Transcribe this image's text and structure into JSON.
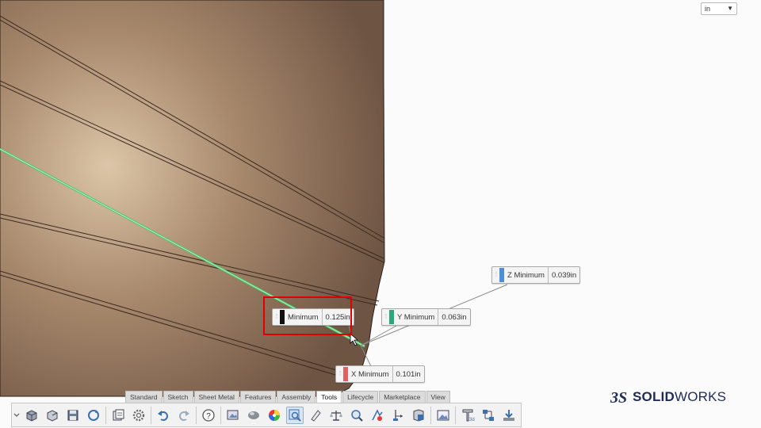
{
  "units": {
    "selected": "in"
  },
  "callouts": {
    "minimum": {
      "label": "Minimum",
      "value": "0.125in",
      "color": "#111111"
    },
    "y_minimum": {
      "label": "Y Minimum",
      "value": "0.063in",
      "color": "#2aa87a"
    },
    "z_minimum": {
      "label": "Z Minimum",
      "value": "0.039in",
      "color": "#4a8fd8"
    },
    "x_minimum": {
      "label": "X Minimum",
      "value": "0.101in",
      "color": "#e06060"
    }
  },
  "command_tabs": [
    "Standard",
    "Sketch",
    "Sheet Metal",
    "Features",
    "Assembly",
    "Tools",
    "Lifecycle",
    "Marketplace",
    "View"
  ],
  "active_tab": "Tools",
  "toolbar_icons": [
    "new-part-icon",
    "open-icon",
    "save-icon",
    "rebuild-icon",
    "options-doc-icon",
    "settings-gear-icon",
    "undo-icon",
    "redo-icon",
    "help-icon",
    "render-tools-icon",
    "appearance-icon",
    "color-wheel-icon",
    "measure-icon",
    "sketch-tool-icon",
    "mass-properties-icon",
    "section-view-icon",
    "interference-icon",
    "dimension-expert-icon",
    "check-icon",
    "photo-icon",
    "3d-text-icon",
    "compare-icon",
    "export-icon"
  ],
  "brand": {
    "logo_mark": "3S",
    "name_bold": "SOLID",
    "name_regular": "WORKS",
    "color": "#1e2c56"
  },
  "colors": {
    "model_surface": "#9a7c62",
    "highlight": "#e00000",
    "edge_select": "#4cc36a"
  }
}
